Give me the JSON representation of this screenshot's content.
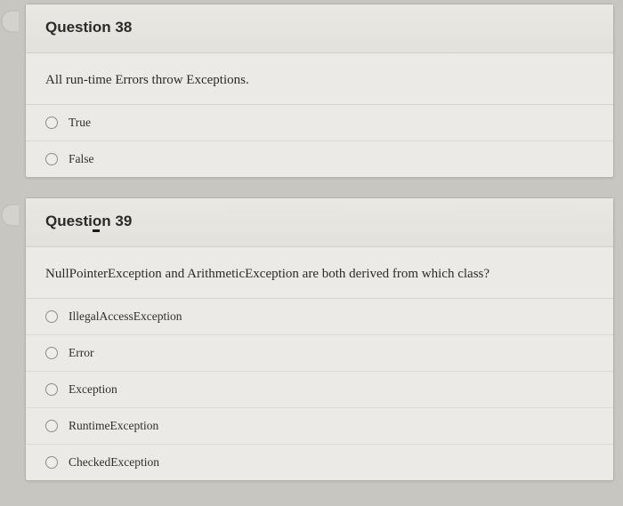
{
  "questions": [
    {
      "title": "Question 38",
      "prompt": "All run-time Errors throw Exceptions.",
      "options": [
        "True",
        "False"
      ]
    },
    {
      "title": "Question 39",
      "prompt": "NullPointerException and ArithmeticException are both derived from which class?",
      "options": [
        "IllegalAccessException",
        "Error",
        "Exception",
        "RuntimeException",
        "CheckedException"
      ]
    }
  ]
}
